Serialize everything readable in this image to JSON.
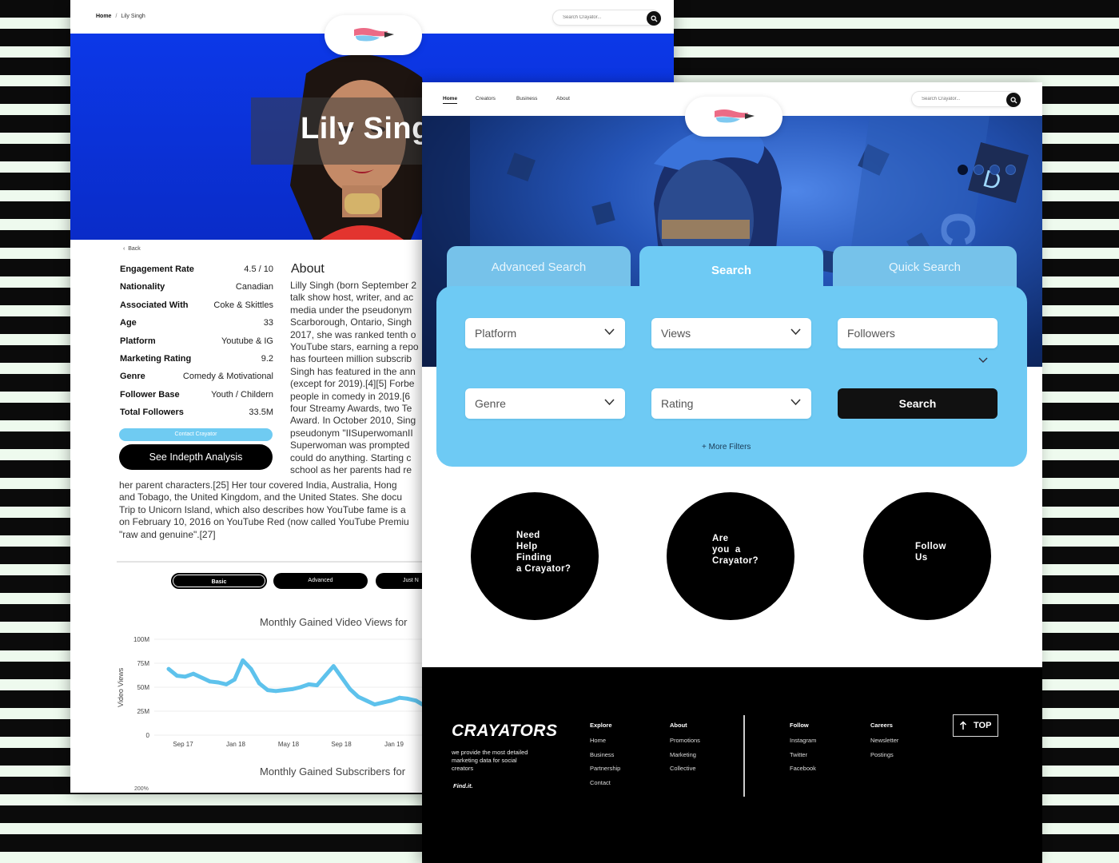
{
  "profile": {
    "breadcrumb": {
      "home": "Home",
      "separator": "/",
      "current": "Lily Singh"
    },
    "search": {
      "placeholder": "Search Crayator..."
    },
    "hero": {
      "name": "Lily Singh"
    },
    "back": "Back",
    "stats": [
      {
        "label": "Engagement Rate",
        "value": "4.5 / 10"
      },
      {
        "label": "Nationality",
        "value": "Canadian"
      },
      {
        "label": "Associated With",
        "value": "Coke & Skittles"
      },
      {
        "label": "Age",
        "value": "33"
      },
      {
        "label": "Platform",
        "value": "Youtube & IG"
      },
      {
        "label": "Marketing Rating",
        "value": "9.2"
      },
      {
        "label": "Genre",
        "value": "Comedy & Motivational"
      },
      {
        "label": "Follower Base",
        "value": "Youth / Childern"
      },
      {
        "label": "Total Followers",
        "value": "33.5M"
      }
    ],
    "contact_label": "Contact Crayator",
    "indepth_label": "See Indepth Analysis",
    "about_heading": "About",
    "about_lines": [
      "Lilly Singh (born September 2",
      "talk show host, writer, and ac",
      "media under the pseudonym",
      "Scarborough, Ontario, Singh",
      "2017, she was ranked tenth o",
      "YouTube stars, earning a repo",
      "has fourteen million subscrib",
      "Singh has featured in the ann",
      "(except for 2019).[4][5] Forbe",
      "people in comedy in 2019.[6",
      "four Streamy Awards, two Te",
      "Award. In October 2010, Sing",
      "pseudonym \"IISuperwomanII",
      "Superwoman was prompted",
      "could do anything. Starting c",
      "school as her parents had re"
    ],
    "about_lines_wide": [
      "her parent characters.[25] Her tour covered India, Australia, Hong",
      "and Tobago, the United Kingdom, and the United States. She docu",
      "Trip to Unicorn Island, which also describes how YouTube fame is a",
      "on February 10, 2016 on YouTube Red (now called YouTube Premiu",
      "\"raw and genuine\".[27]"
    ],
    "analysis_tabs": [
      "Basic",
      "Advanced",
      "Just N"
    ],
    "chart_title_1": "Monthly Gained Video Views for",
    "chart_title_2": "Monthly Gained Subscribers for",
    "chart_cut_label": "200%"
  },
  "chart_data": {
    "type": "line",
    "title": "Monthly Gained Video Views for",
    "ylabel": "Video Views",
    "xlabel": "",
    "ylim": [
      0,
      100
    ],
    "y_ticks": [
      "0",
      "25M",
      "50M",
      "75M",
      "100M"
    ],
    "x_ticks": [
      "Sep 17",
      "Jan 18",
      "May 18",
      "Sep 18",
      "Jan 19"
    ],
    "series": [
      {
        "name": "",
        "color": "#5ec2ec",
        "values": [
          69,
          62,
          61,
          64,
          60,
          56,
          55,
          53,
          58,
          78,
          69,
          54,
          47,
          46,
          47,
          48,
          50,
          53,
          52,
          62,
          72,
          60,
          48,
          40,
          36,
          32,
          34,
          36,
          39,
          38,
          36,
          31,
          25
        ]
      }
    ]
  },
  "search": {
    "nav": [
      "Home",
      "Creators",
      "Business",
      "About"
    ],
    "search_placeholder": "Search Crayator...",
    "tabs": [
      "Advanced Search",
      "Search",
      "Quick Search"
    ],
    "filters": [
      "Platform",
      "Views",
      "Followers",
      "Genre",
      "Rating"
    ],
    "search_button": "Search",
    "more_filters": "+ More Filters",
    "circles": [
      "Need\nHelp\nFinding\na Crayator?",
      "Are\nyou  a\nCrayator?",
      "Follow\nUs"
    ],
    "accent": "#6ecaf4"
  },
  "footer": {
    "brand": "CRAYATORS",
    "tagline": "we provide the most detailed marketing data for social creators",
    "slogan": "Find.it.",
    "explore": {
      "heading": "Explore",
      "items": [
        "Home",
        "Business",
        "Partnership",
        "Contact"
      ]
    },
    "about": {
      "heading": "About",
      "items": [
        "Promotions",
        "Marketing",
        "Collective"
      ]
    },
    "follow": {
      "heading": "Follow",
      "items": [
        "Instagram",
        "Twitter",
        "Facebook"
      ]
    },
    "careers": {
      "heading": "Careers",
      "items": [
        "Newsletter",
        "Postings"
      ]
    },
    "top_label": "TOP"
  }
}
